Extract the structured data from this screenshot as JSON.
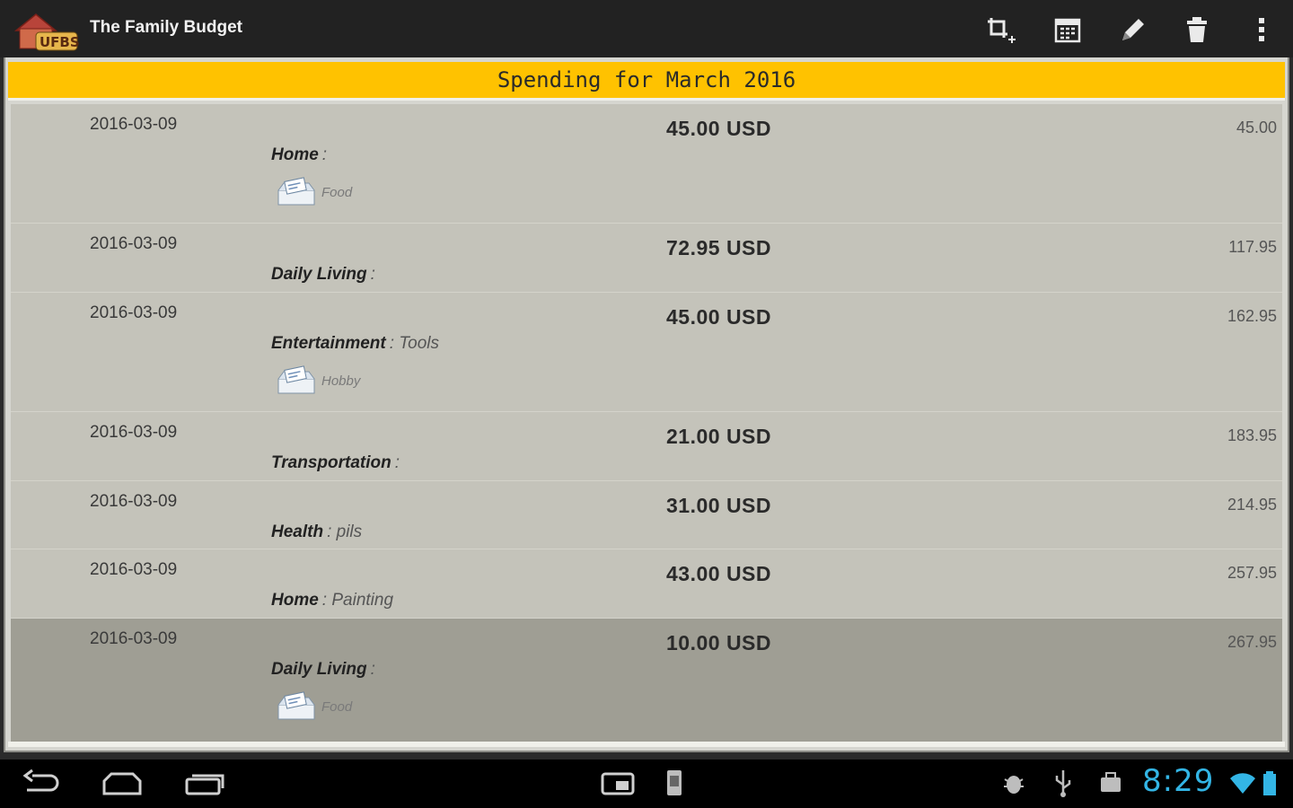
{
  "app": {
    "title": "The Family Budget",
    "logo_text": "UFBS"
  },
  "actions": [
    {
      "name": "crop-icon"
    },
    {
      "name": "calendar-icon"
    },
    {
      "name": "edit-icon"
    },
    {
      "name": "delete-icon"
    },
    {
      "name": "overflow-menu-icon"
    }
  ],
  "header": {
    "title": "Spending for March 2016"
  },
  "rows": [
    {
      "date": "2016-03-09",
      "amount": "45.00 USD",
      "running": "45.00",
      "category": "Home",
      "subcategory": "",
      "tag": "Food",
      "selected": false
    },
    {
      "date": "2016-03-09",
      "amount": "72.95 USD",
      "running": "117.95",
      "category": "Daily Living",
      "subcategory": "",
      "tag": "",
      "selected": false
    },
    {
      "date": "2016-03-09",
      "amount": "45.00 USD",
      "running": "162.95",
      "category": "Entertainment",
      "subcategory": "Tools",
      "tag": "Hobby",
      "selected": false
    },
    {
      "date": "2016-03-09",
      "amount": "21.00 USD",
      "running": "183.95",
      "category": "Transportation",
      "subcategory": "",
      "tag": "",
      "selected": false
    },
    {
      "date": "2016-03-09",
      "amount": "31.00 USD",
      "running": "214.95",
      "category": "Health",
      "subcategory": "pils",
      "tag": "",
      "selected": false
    },
    {
      "date": "2016-03-09",
      "amount": "43.00 USD",
      "running": "257.95",
      "category": "Home",
      "subcategory": "Painting",
      "tag": "",
      "selected": false
    },
    {
      "date": "2016-03-09",
      "amount": "10.00 USD",
      "running": "267.95",
      "category": "Daily Living",
      "subcategory": "",
      "tag": "Food",
      "selected": true
    }
  ],
  "category_separator": ":",
  "status": {
    "time": "8:29"
  },
  "colors": {
    "header_bg": "#ffc200",
    "list_bg": "#c4c3ba",
    "selected_bg": "#9f9e94",
    "clock": "#33b5e5"
  }
}
